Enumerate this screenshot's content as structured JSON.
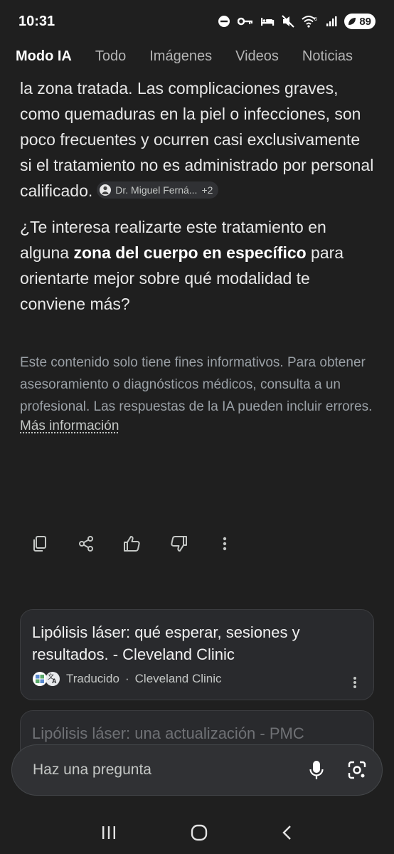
{
  "status_bar": {
    "time": "10:31",
    "battery": "89",
    "icons": [
      "do-not-disturb-icon",
      "key-icon",
      "bed-icon",
      "mute-icon",
      "wifi-5-icon",
      "signal-icon",
      "battery-saver-icon"
    ]
  },
  "tabs": [
    {
      "label": "Modo IA",
      "active": true
    },
    {
      "label": "Todo"
    },
    {
      "label": "Imágenes"
    },
    {
      "label": "Videos"
    },
    {
      "label": "Noticias"
    }
  ],
  "answer": {
    "para1": "la zona tratada. Las complicaciones graves, como quemaduras en la piel o infecciones, son poco frecuentes y ocurren casi exclusivamente si el tratamiento no es administrado por personal calificado.",
    "source_chip": {
      "label": "Dr. Miguel Ferná...",
      "extra": "+2"
    },
    "para2_before": "¿Te interesa realizarte este tratamiento en alguna ",
    "para2_bold": "zona del cuerpo en específico",
    "para2_after": " para orientarte mejor sobre qué modalidad te conviene más?"
  },
  "disclaimer": {
    "text": "Este contenido solo tiene fines informativos. Para obtener asesoramiento o diagnósticos médicos, consulta a un profesional. Las respuestas de la IA pueden incluir errores.",
    "link": "Más información"
  },
  "action_icons": [
    "copy-icon",
    "share-icon",
    "thumbs-up-icon",
    "thumbs-down-icon",
    "more-vert-icon"
  ],
  "cards": [
    {
      "title": "Lipólisis láser: qué esperar, sesiones y resultados. - Cleveland Clinic",
      "translated": "Traducido",
      "source": "Cleveland Clinic"
    },
    {
      "title": "Lipólisis láser: una actualización - PMC"
    }
  ],
  "ask": {
    "placeholder": "Haz una pregunta"
  },
  "nav_icons": [
    "recents-icon",
    "home-icon",
    "back-icon"
  ]
}
